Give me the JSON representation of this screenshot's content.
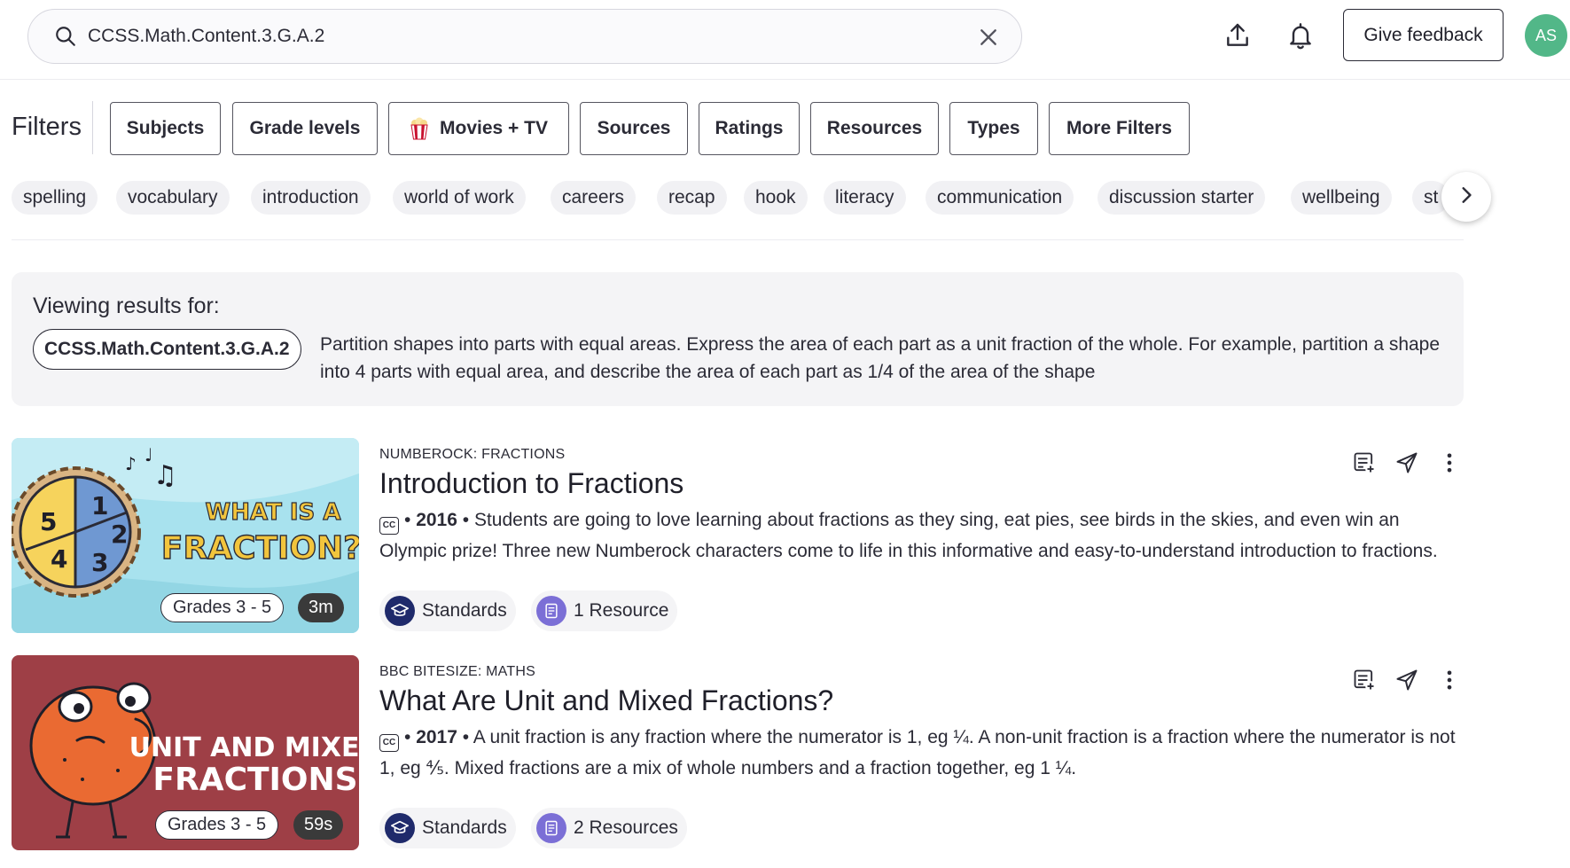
{
  "search": {
    "value": "CCSS.Math.Content.3.G.A.2",
    "placeholder": ""
  },
  "header": {
    "feedback_label": "Give feedback",
    "avatar_initials": "AS"
  },
  "filters": {
    "label": "Filters",
    "buttons": [
      "Subjects",
      "Grade levels",
      "Movies + TV",
      "Sources",
      "Ratings",
      "Resources",
      "Types",
      "More Filters"
    ]
  },
  "chips": [
    "spelling",
    "vocabulary",
    "introduction",
    "world of work",
    "careers",
    "recap",
    "hook",
    "literacy",
    "communication",
    "discussion starter",
    "wellbeing",
    "st"
  ],
  "viewing": {
    "label": "Viewing results for:",
    "code": "CCSS.Math.Content.3.G.A.2",
    "description": "Partition shapes into parts with equal areas. Express the area of each part as a unit fraction of the whole. For example, partition a shape into 4 parts with equal area, and describe the area of each part as 1/4 of the area of the shape"
  },
  "results": [
    {
      "source": "NUMBEROCK: FRACTIONS",
      "title": "Introduction to Fractions",
      "cc_label": "CC",
      "year": "2016",
      "description": "Students are going to love learning about fractions as they sing, eat pies, see birds in the skies, and even win an Olympic prize! Three new Numberock characters come to life in this informative and easy-to-understand introduction to fractions.",
      "grades": "Grades 3 - 5",
      "duration": "3m",
      "thumb_text_1": "WHAT IS A",
      "thumb_text_2": "FRACTION?",
      "pie_numbers": [
        "1",
        "2",
        "3",
        "4",
        "5"
      ],
      "tags": {
        "standards": "Standards",
        "resources": "1 Resource"
      }
    },
    {
      "source": "BBC BITESIZE: MATHS",
      "title": "What Are Unit and Mixed Fractions?",
      "cc_label": "CC",
      "year": "2017",
      "description": "A unit fraction is any fraction where the numerator is 1, eg ¼. A non-unit fraction is a fraction where the numerator is not 1, eg ⅘. Mixed fractions are a mix of whole numbers and a fraction together, eg 1 ¼.",
      "grades": "Grades 3 - 5",
      "duration": "59s",
      "thumb_text_1": "UNIT AND MIXED",
      "thumb_text_2": "FRACTIONS",
      "tags": {
        "standards": "Standards",
        "resources": "2 Resources"
      }
    }
  ],
  "colors": {
    "avatar": "#52b788",
    "thumb1_bg": "#a8e2ee",
    "thumb2_bg": "#9e3f46",
    "standards_icon": "#1f2a6b",
    "resource_icon": "#7b6fd6"
  },
  "icons": {
    "search": "search-icon",
    "clear": "close-icon",
    "upload": "upload-icon",
    "bell": "bell-icon",
    "popcorn": "popcorn-icon",
    "chevron": "chevron-right-icon",
    "playlist": "playlist-add-icon",
    "send": "send-icon",
    "more": "more-vertical-icon",
    "standards": "graduation-cap-icon",
    "resources": "document-icon"
  }
}
